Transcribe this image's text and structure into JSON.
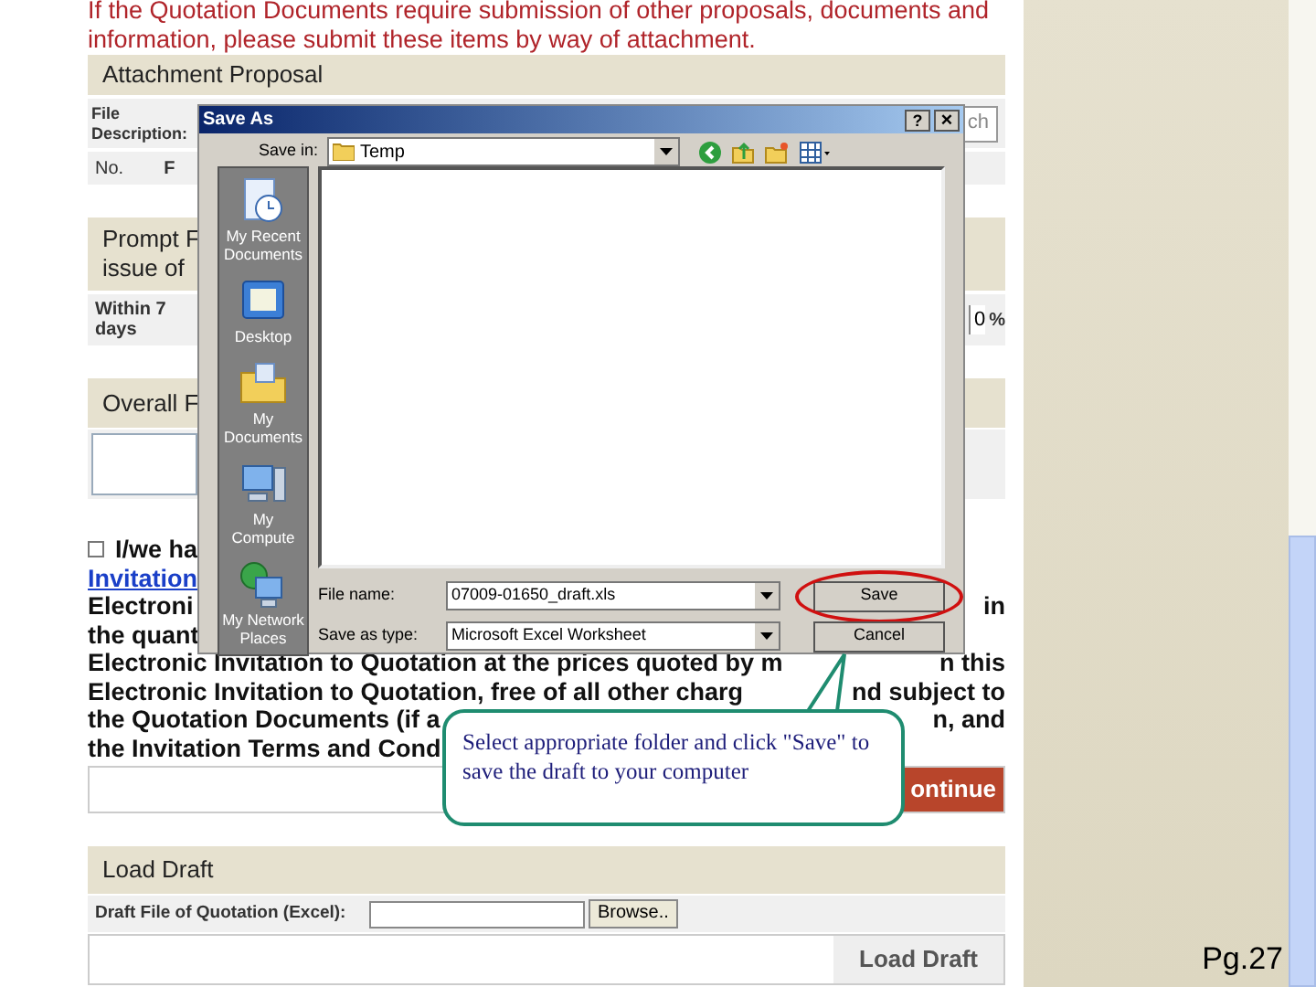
{
  "notice": "If the Quotation Documents require submission of other proposals, documents and information, please submit these items by way of attachment.",
  "attachment_section": {
    "title": "Attachment Proposal",
    "file_description_label": "File Description:",
    "attach_button": "ch",
    "columns": [
      "No.",
      "F"
    ]
  },
  "prompt_section": {
    "title_lines": [
      "Prompt F",
      "issue of"
    ],
    "row_label": "Within 7 days",
    "value": "0",
    "unit": "%"
  },
  "overall_section": {
    "title": "Overall F"
  },
  "declaration": {
    "checked": false,
    "lines": [
      {
        "kind": "checkbox",
        "parts": [
          "I/we ha"
        ]
      },
      {
        "kind": "link",
        "parts": [
          "Invitation"
        ]
      },
      {
        "kind": "text",
        "parts": [
          "Electroni",
          "in"
        ]
      },
      {
        "kind": "text",
        "parts": [
          "the quant"
        ]
      },
      {
        "kind": "text",
        "parts": [
          "Electronic Invitation to Quotation at the prices quoted by m",
          "n this"
        ]
      },
      {
        "kind": "text",
        "parts": [
          "Electronic Invitation to Quotation, free of all other charg",
          "nd subject to"
        ]
      },
      {
        "kind": "text",
        "parts": [
          "the Quotation Documents (if a",
          "n, and"
        ]
      },
      {
        "kind": "text",
        "parts": [
          "the Invitation Terms and Cond"
        ]
      }
    ]
  },
  "continue_button": "ontinue",
  "load_draft": {
    "title": "Load Draft",
    "file_label": "Draft File of Quotation (Excel):",
    "browse_button": "Browse..",
    "load_button": "Load Draft"
  },
  "dialog": {
    "title": "Save As",
    "help_button": "?",
    "close_button": "×",
    "save_in_label": "Save in:",
    "save_in_value": "Temp",
    "places": [
      {
        "kind": "recent",
        "label": "My Recent Documents"
      },
      {
        "kind": "desktop",
        "label": "Desktop"
      },
      {
        "kind": "documents",
        "label": "My Documents"
      },
      {
        "kind": "computer",
        "label": "My Compute"
      },
      {
        "kind": "network",
        "label": "My Network Places"
      }
    ],
    "file_name_label": "File name:",
    "file_name_value": "07009-01650_draft.xls",
    "type_label": "Save as type:",
    "type_value": "Microsoft Excel Worksheet",
    "save_button": "Save",
    "cancel_button": "Cancel",
    "save_highlighted": true
  },
  "callout": "Select appropriate folder and click \"Save\" to save the draft to your computer",
  "page_number": "Pg.27"
}
